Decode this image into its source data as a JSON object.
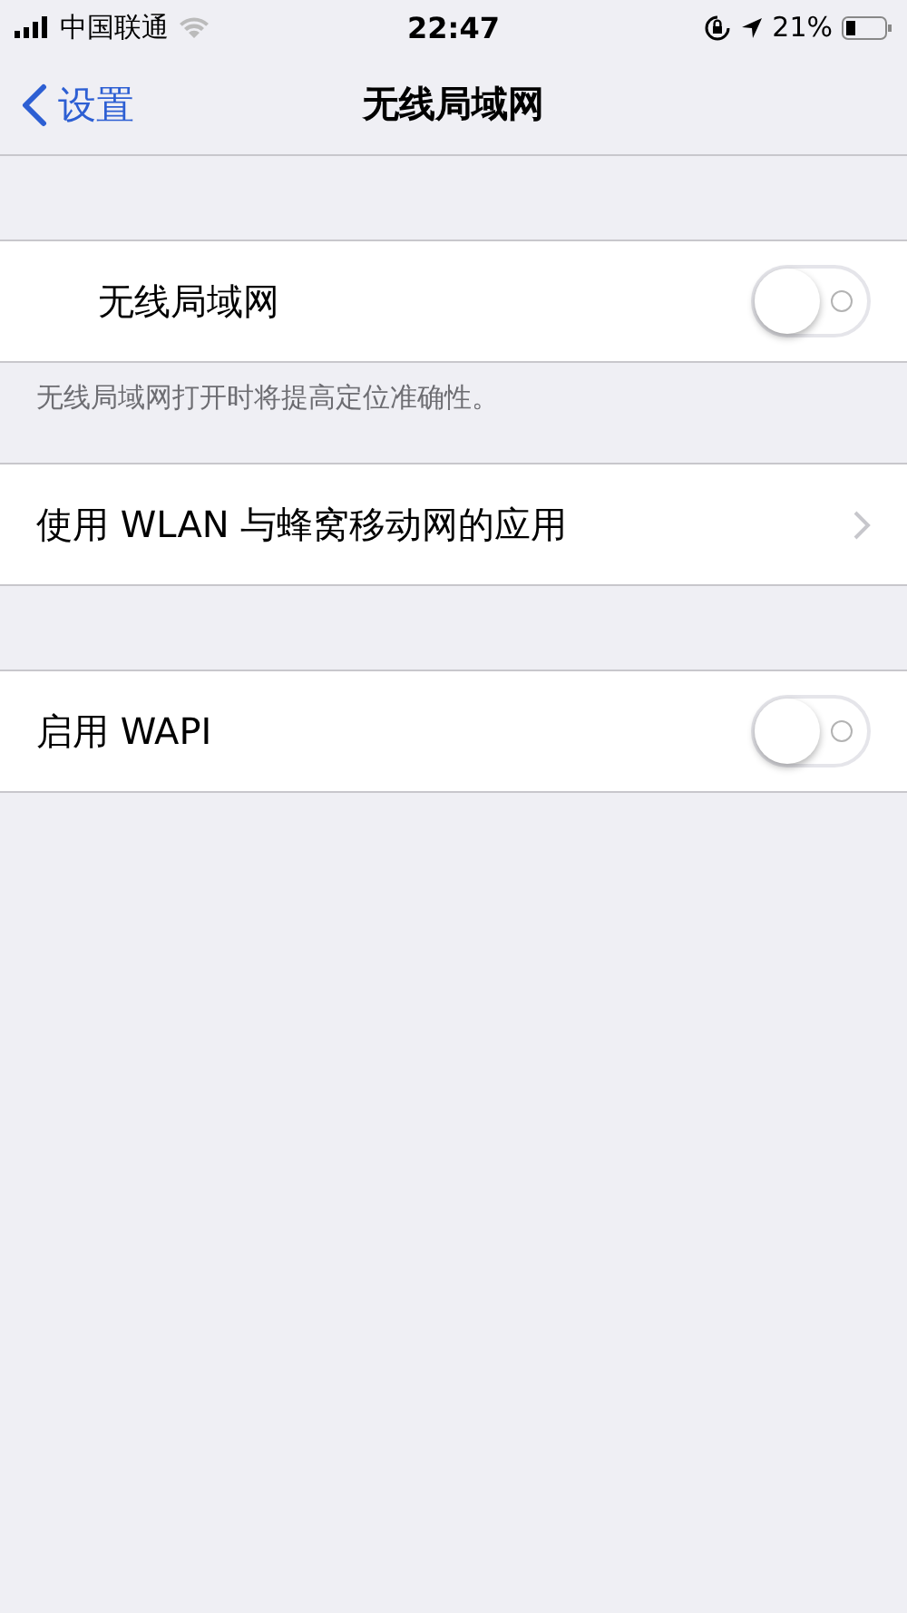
{
  "status_bar": {
    "carrier": "中国联通",
    "time": "22:47",
    "battery": "21%"
  },
  "nav": {
    "back": "设置",
    "title": "无线局域网"
  },
  "groups": [
    {
      "rows": [
        {
          "kind": "toggle",
          "label": "无线局域网",
          "on": false,
          "inset": true
        }
      ],
      "footer": "无线局域网打开时将提高定位准确性。"
    },
    {
      "rows": [
        {
          "kind": "link",
          "label": "使用 WLAN 与蜂窝移动网的应用",
          "inset": false
        }
      ]
    },
    {
      "rows": [
        {
          "kind": "toggle",
          "label": "启用 WAPI",
          "on": false,
          "inset": false
        }
      ]
    }
  ]
}
